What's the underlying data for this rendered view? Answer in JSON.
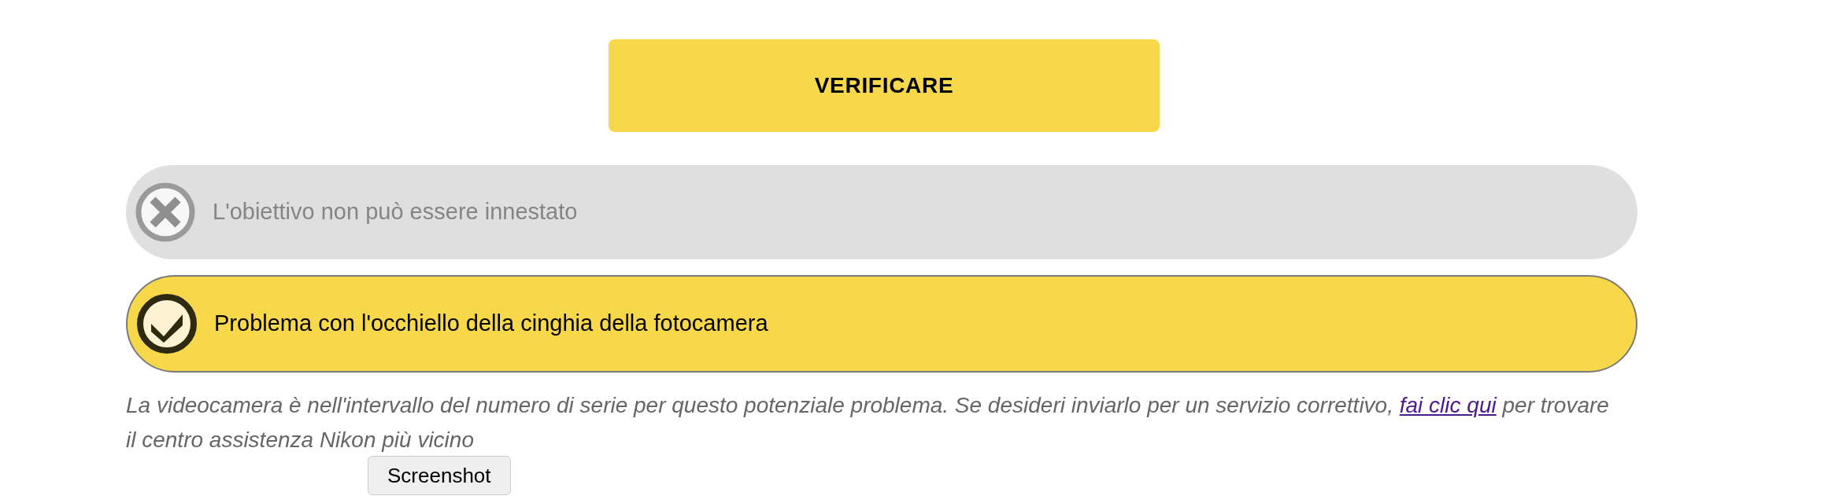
{
  "verify_button": "VERIFICARE",
  "options": [
    {
      "label": "L'obiettivo non può essere innestato",
      "selected": false
    },
    {
      "label": "Problema con l'occhiello della cinghia della fotocamera",
      "selected": true
    }
  ],
  "message": {
    "before": "La videocamera è nell'intervallo del numero di serie per questo potenziale problema. Se desideri inviarlo per un servizio correttivo,",
    "link": "fai clic qui",
    "after": "per trovare il centro assistenza Nikon più vicino"
  },
  "screenshot_button": "Screenshot"
}
